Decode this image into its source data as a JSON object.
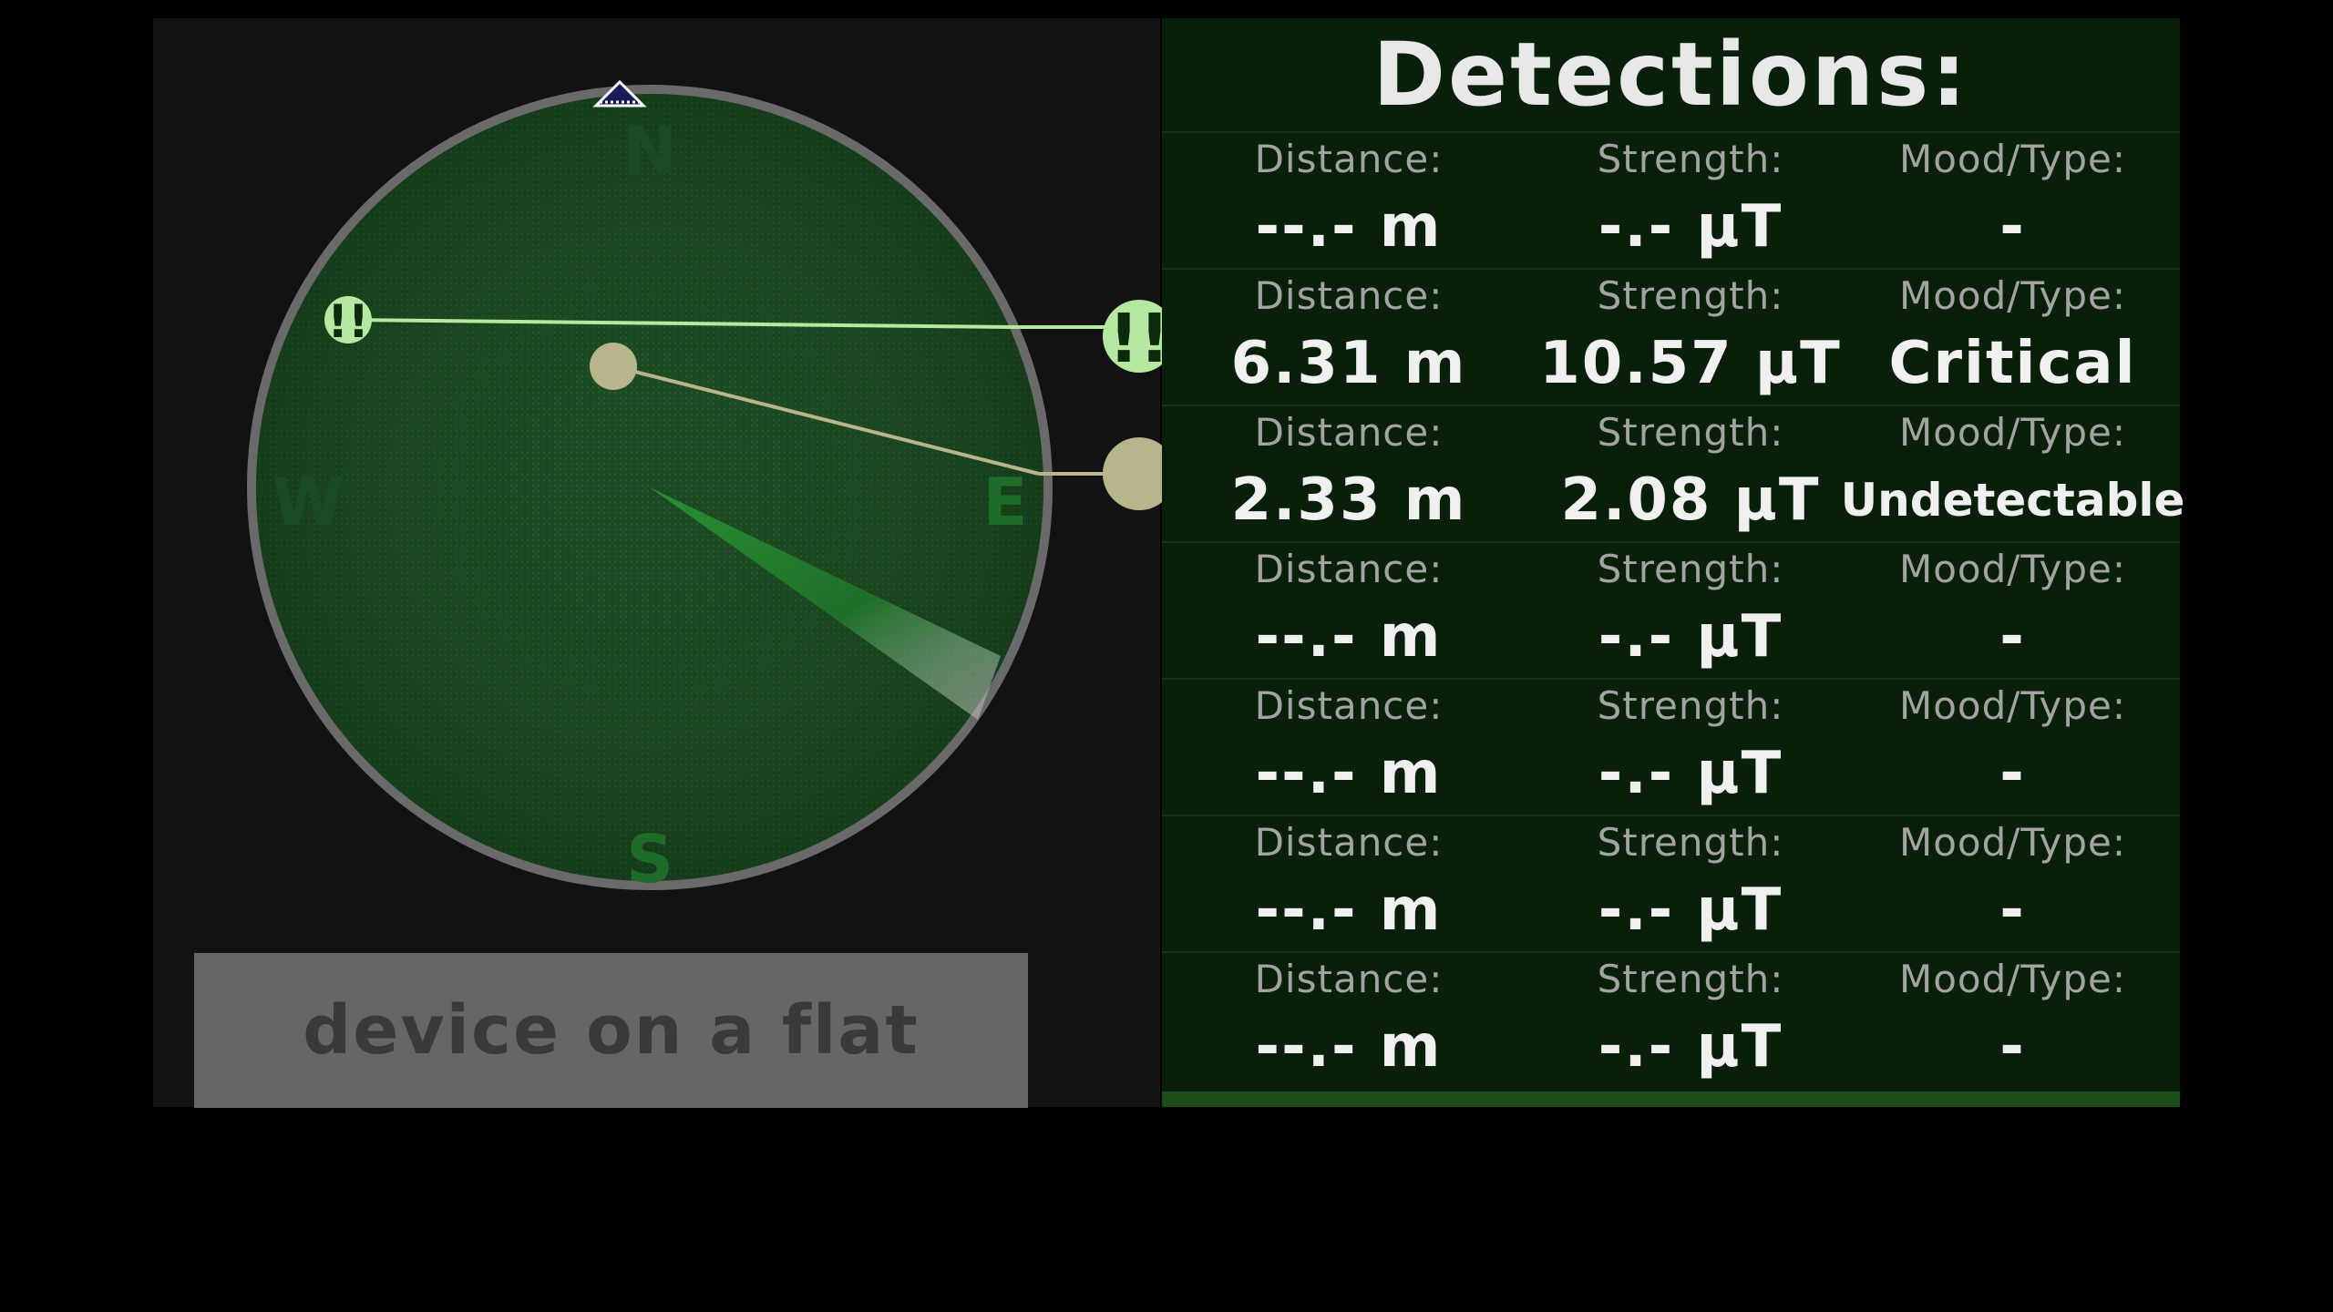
{
  "radar": {
    "compass": {
      "north": "N",
      "south": "S",
      "east": "E",
      "west": "W"
    },
    "markers": [
      {
        "name": "critical",
        "label": "!!"
      },
      {
        "name": "undetectable",
        "label": ""
      }
    ]
  },
  "calibrate_button": {
    "label": "device on a flat"
  },
  "detections": {
    "title": "Detections:",
    "rows": [
      {
        "distance_label": "Distance:",
        "distance": "--.- m",
        "strength_label": "Strength:",
        "strength": "-.- μT",
        "mood_label": "Mood/Type:",
        "mood": "-"
      },
      {
        "distance_label": "Distance:",
        "distance": "6.31 m",
        "strength_label": "Strength:",
        "strength": "10.57 μT",
        "mood_label": "Mood/Type:",
        "mood": "Critical"
      },
      {
        "distance_label": "Distance:",
        "distance": "2.33 m",
        "strength_label": "Strength:",
        "strength": "2.08 μT",
        "mood_label": "Mood/Type:",
        "mood": "Undetectable"
      },
      {
        "distance_label": "Distance:",
        "distance": "--.- m",
        "strength_label": "Strength:",
        "strength": "-.- μT",
        "mood_label": "Mood/Type:",
        "mood": "-"
      },
      {
        "distance_label": "Distance:",
        "distance": "--.- m",
        "strength_label": "Strength:",
        "strength": "-.- μT",
        "mood_label": "Mood/Type:",
        "mood": "-"
      },
      {
        "distance_label": "Distance:",
        "distance": "--.- m",
        "strength_label": "Strength:",
        "strength": "-.- μT",
        "mood_label": "Mood/Type:",
        "mood": "-"
      },
      {
        "distance_label": "Distance:",
        "distance": "--.- m",
        "strength_label": "Strength:",
        "strength": "-.- μT",
        "mood_label": "Mood/Type:",
        "mood": "-"
      }
    ]
  },
  "colors": {
    "radar_fill": "#1c4a22",
    "radar_rim": "#6a6a6a",
    "critical_marker": "#b5e8a0",
    "undetectable_marker": "#b8b48c",
    "compass_letter": "#1f6b2a",
    "panel_bg": "#0a1f0a",
    "strip": "#1a4d1a"
  },
  "icons": {
    "north_indicator": "triangle-up-icon",
    "critical": "double-exclamation-icon",
    "undetectable": "circle-icon"
  }
}
